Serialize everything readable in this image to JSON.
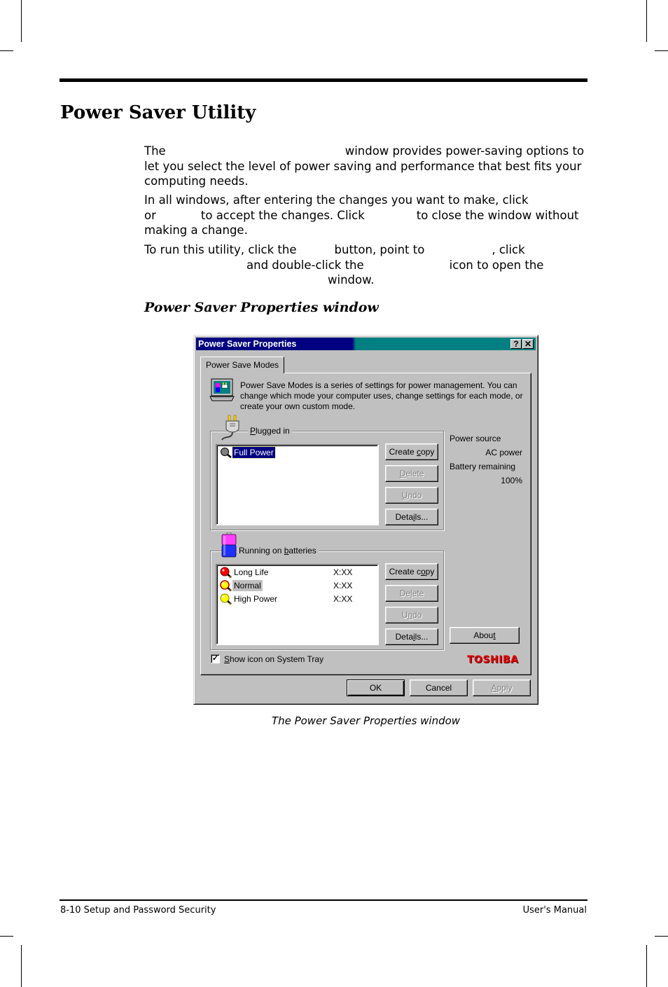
{
  "page": {
    "title": "Power Saver Utility",
    "paragraphs": {
      "p1_a": "The",
      "p1_b": "window provides power-saving options to let you select the level of power saving and performance that best fits your computing needs.",
      "p2_a": "In all windows, after entering the changes you want to make, click",
      "p2_b": "or",
      "p2_c": "to accept the changes. Click",
      "p2_d": "to close the window without making a change.",
      "p3_a": "To run this utility, click the",
      "p3_b": "button, point to",
      "p3_c": ", click",
      "p3_d": "and double-click the",
      "p3_e": "icon to open the",
      "p3_f": "window."
    },
    "section_heading": "Power Saver Properties window",
    "figure_caption": "The Power Saver Properties window",
    "footer": {
      "left": "8-10  Setup and Password Security",
      "right": "User's Manual"
    }
  },
  "dialog": {
    "title": "Power Saver Properties",
    "help_button": "?",
    "close_button": "✕",
    "tab": "Power Save Modes",
    "intro": "Power Save Modes is a series of settings for power management. You can change which mode your computer uses, change settings for each mode, or create your own custom mode.",
    "plugged_in": {
      "label_pre": "",
      "label_u": "P",
      "label_post": "lugged in",
      "items": [
        {
          "name": "Full Power",
          "icon": "gray-magnifier-icon",
          "selected": true
        }
      ],
      "buttons": {
        "create": {
          "pre": "Create ",
          "u": "c",
          "post": "opy"
        },
        "delete": {
          "pre": "",
          "u": "D",
          "post": "elete"
        },
        "undo": {
          "pre": "",
          "u": "U",
          "post": "ndo"
        },
        "details": {
          "pre": "Deta",
          "u": "i",
          "post": "ls..."
        }
      }
    },
    "batteries": {
      "label_pre": "Running on ",
      "label_u": "b",
      "label_post": "atteries",
      "items": [
        {
          "name": "Long Life",
          "time": "X:XX",
          "color": "#ff0000"
        },
        {
          "name": "Normal",
          "time": "X:XX",
          "color": "#ffff00"
        },
        {
          "name": "High Power",
          "time": "X:XX",
          "color": "#ffff00"
        }
      ],
      "buttons": {
        "create": {
          "pre": "Create c",
          "u": "o",
          "post": "py"
        },
        "delete": {
          "pre": "De",
          "u": "l",
          "post": "ete"
        },
        "undo": {
          "pre": "U",
          "u": "n",
          "post": "do"
        },
        "details": {
          "pre": "Deta",
          "u": "i",
          "post": "ls..."
        }
      }
    },
    "status": {
      "power_source_label": "Power source",
      "power_source_value": "AC power",
      "battery_label": "Battery remaining",
      "battery_value": "100%"
    },
    "about": {
      "pre": "Abou",
      "u": "t",
      "post": ""
    },
    "show_tray": {
      "pre": "",
      "u": "S",
      "post": "how icon on System Tray",
      "checked": true
    },
    "brand": "TOSHIBA",
    "ok": "OK",
    "cancel": "Cancel",
    "apply": {
      "pre": "",
      "u": "A",
      "post": "pply"
    },
    "colors": {
      "title_active": "#000080",
      "title_inactive": "#008080",
      "face": "#c0c0c0",
      "brand": "#e00000"
    }
  }
}
